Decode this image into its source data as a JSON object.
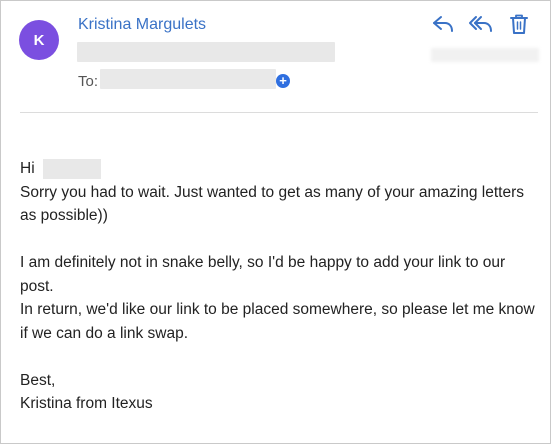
{
  "email": {
    "sender_initial": "K",
    "sender_name": "Kristina Margulets",
    "to_label": "To:",
    "add_recipient_glyph": "+",
    "greeting": "Hi",
    "paragraph1": "Sorry you had to wait. Just wanted to get as many of your amazing letters as possible))",
    "paragraph2_line1": "I am definitely not in snake belly, so I'd be happy to add your link to our post.",
    "paragraph2_line2": "In return, we'd like our link to be placed somewhere, so please let me know if we can do a link swap.",
    "signoff": "Best,",
    "signature": "Kristina from Itexus"
  },
  "toolbar": {
    "icons": [
      "reply-icon",
      "reply-all-icon",
      "trash-icon"
    ]
  },
  "colors": {
    "avatar": "#7b4fe0",
    "accent": "#3a72c6",
    "add_button": "#2f6fe0"
  }
}
